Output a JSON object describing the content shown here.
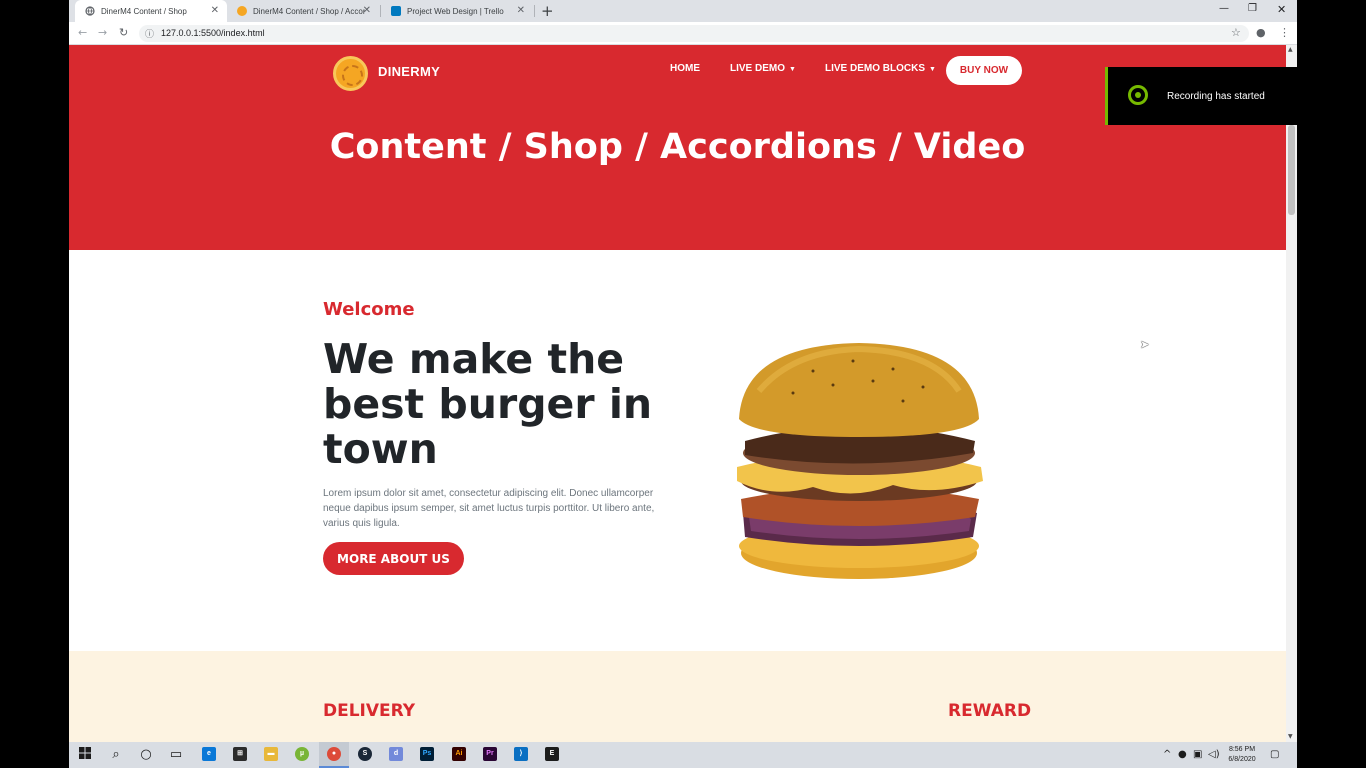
{
  "browser": {
    "tabs": [
      {
        "label": "DinerM4 Content / Shop",
        "active": true
      },
      {
        "label": "DinerM4 Content / Shop / Accor...",
        "active": false
      },
      {
        "label": "Project Web Design | Trello",
        "active": false
      }
    ],
    "url": "127.0.0.1:5500/index.html"
  },
  "site": {
    "brand": "DINERMY",
    "nav": {
      "home": "HOME",
      "live_demo": "LIVE DEMO",
      "live_demo_blocks": "LIVE DEMO BLOCKS",
      "buy_now": "BUY NOW"
    },
    "hero_title": "Content / Shop / Accordions / Video",
    "welcome": "Welcome",
    "headline": "We make the best burger in town",
    "lorem": "Lorem ipsum dolor sit amet, consectetur adipiscing elit. Donec ullamcorper neque dapibus ipsum semper, sit amet luctus turpis porttitor. Ut libero ante, varius quis ligula.",
    "more_button": "MORE ABOUT US",
    "features": {
      "delivery": "DELIVERY",
      "reward": "REWARD"
    }
  },
  "notification": {
    "message": "Recording has started"
  },
  "taskbar": {
    "clock_time": "8:56 PM",
    "clock_date": "6/8/2020"
  },
  "colors": {
    "brand_red": "#d8292f",
    "band_cream": "#fdf3e1",
    "nvidia_green": "#76b900"
  }
}
